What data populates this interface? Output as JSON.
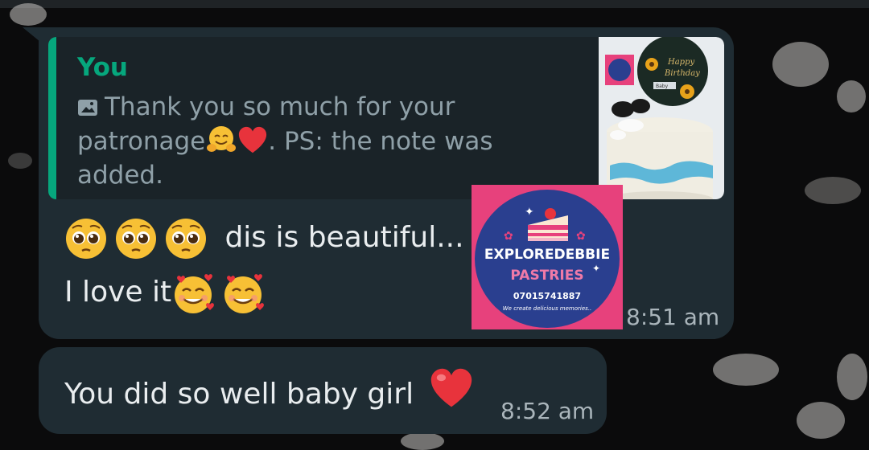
{
  "colors": {
    "bubble": "#1f2c33",
    "quote_accent": "#06a77d",
    "text": "#e9edef",
    "time": "#aab5bb"
  },
  "message1": {
    "quote": {
      "author": "You",
      "icon": "photo-icon",
      "text_part1": "Thank you so much for your patronage",
      "text_part2": ". PS: the note was added."
    },
    "line1": "dis is beautiful...",
    "line2": "I love it",
    "time": "8:51 am",
    "sticker": {
      "brand": "EXPLOREDEBBIE",
      "sub": "PASTRIES",
      "phone": "07015741887",
      "tagline": "We create delicious memories.."
    },
    "thumb_card": {
      "line1": "Happy",
      "line2": "Birthday",
      "name": "Baby"
    }
  },
  "message2": {
    "text": "You did so well baby girl",
    "time": "8:52 am"
  }
}
